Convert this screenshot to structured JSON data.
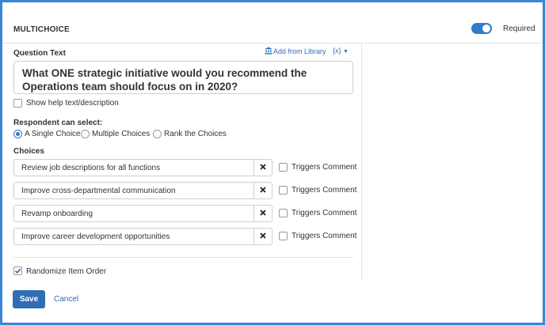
{
  "header": {
    "title": "MULTICHOICE",
    "required_label": "Required",
    "required_on": true
  },
  "question": {
    "label": "Question Text",
    "add_from_library": "Add from Library",
    "variable_button": "{x}",
    "text": "What ONE strategic initiative would you recommend the Operations team should focus on in 2020?",
    "show_help_label": "Show help text/description",
    "show_help_checked": false
  },
  "respondent": {
    "label": "Respondent can select:",
    "options": [
      "A Single Choice",
      "Multiple Choices",
      "Rank the Choices"
    ],
    "selected": "A Single Choice"
  },
  "choices": {
    "label": "Choices",
    "items": [
      {
        "text": "Review job descriptions for all functions",
        "triggers_label": "Triggers Comment",
        "triggers_checked": false
      },
      {
        "text": "Improve cross-departmental communication",
        "triggers_label": "Triggers Comment",
        "triggers_checked": false
      },
      {
        "text": "Revamp onboarding",
        "triggers_label": "Triggers Comment",
        "triggers_checked": false
      },
      {
        "text": "Improve career development opportunities",
        "triggers_label": "Triggers Comment",
        "triggers_checked": false
      }
    ]
  },
  "randomize": {
    "label": "Randomize Item Order",
    "checked": true
  },
  "actions": {
    "save_label": "Save",
    "cancel_label": "Cancel"
  },
  "colors": {
    "accent": "#2f7cc9",
    "link": "#2f6db5",
    "frame": "#3a87d6"
  },
  "icons": {
    "library": "bank-icon",
    "remove": "close-icon",
    "check": "check-icon",
    "dropdown": "caret-down-icon"
  }
}
